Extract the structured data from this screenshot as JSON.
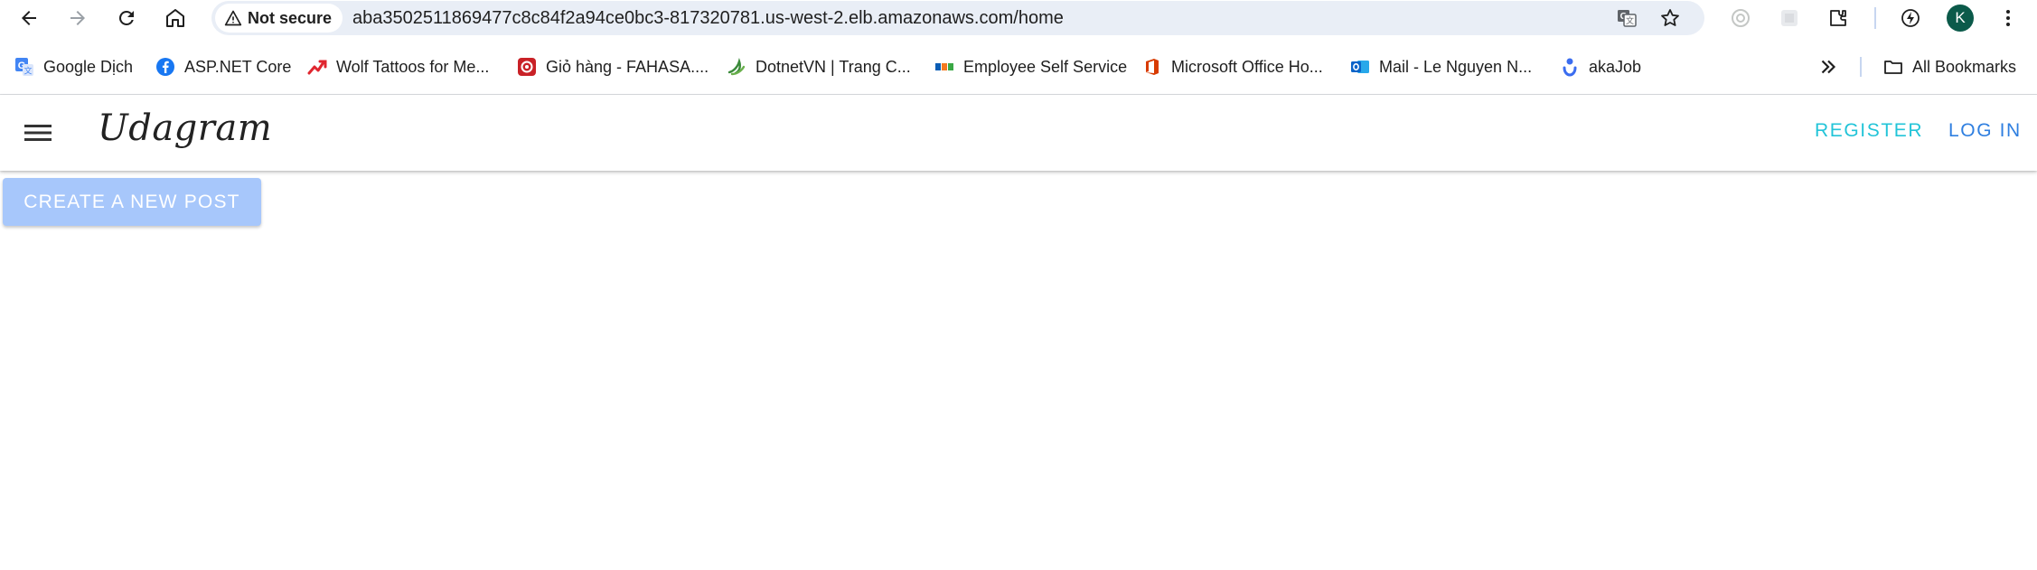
{
  "browser": {
    "security_label": "Not secure",
    "url": "aba3502511869477c8c84f2a94ce0bc3-817320781.us-west-2.elb.amazonaws.com/home",
    "profile_initial": "K",
    "icons": [
      "back-arrow-icon",
      "forward-arrow-icon",
      "reload-icon",
      "home-icon",
      "warning-icon",
      "translate-icon",
      "star-icon",
      "extension-icon",
      "puzzle-icon",
      "performance-icon",
      "more-vertical-icon"
    ]
  },
  "bookmarks": {
    "items": [
      {
        "label": "Google Dịch",
        "icon": "google-translate-icon",
        "color": "#4285f4"
      },
      {
        "label": "ASP.NET Core",
        "icon": "facebook-icon",
        "color": "#1877f2"
      },
      {
        "label": "Wolf Tattoos for Me...",
        "icon": "trend-arrow-icon",
        "color": "#e0262f"
      },
      {
        "label": "Giỏ hàng - FAHASA....",
        "icon": "fahasa-icon",
        "color": "#c92127"
      },
      {
        "label": "DotnetVN | Trang C...",
        "icon": "dotnetvn-icon",
        "color": "#3a8a3a"
      },
      {
        "label": "Employee Self Service",
        "icon": "fpt-icon",
        "color": "#f47920"
      },
      {
        "label": "Microsoft Office Ho...",
        "icon": "office-icon",
        "color": "#d83b01"
      },
      {
        "label": "Mail - Le Nguyen N...",
        "icon": "outlook-icon",
        "color": "#0a64c8"
      },
      {
        "label": "akaJob",
        "icon": "akajob-icon",
        "color": "#3b6df0"
      }
    ],
    "all_bookmarks_label": "All Bookmarks"
  },
  "app": {
    "brand": "Udagram",
    "nav": {
      "register": "REGISTER",
      "login": "LOG IN"
    },
    "create_post_label": "CREATE A NEW POST",
    "colors": {
      "register": "#22c4d8",
      "login": "#2f7fe0",
      "create_button_bg": "#a7c7fb"
    }
  }
}
